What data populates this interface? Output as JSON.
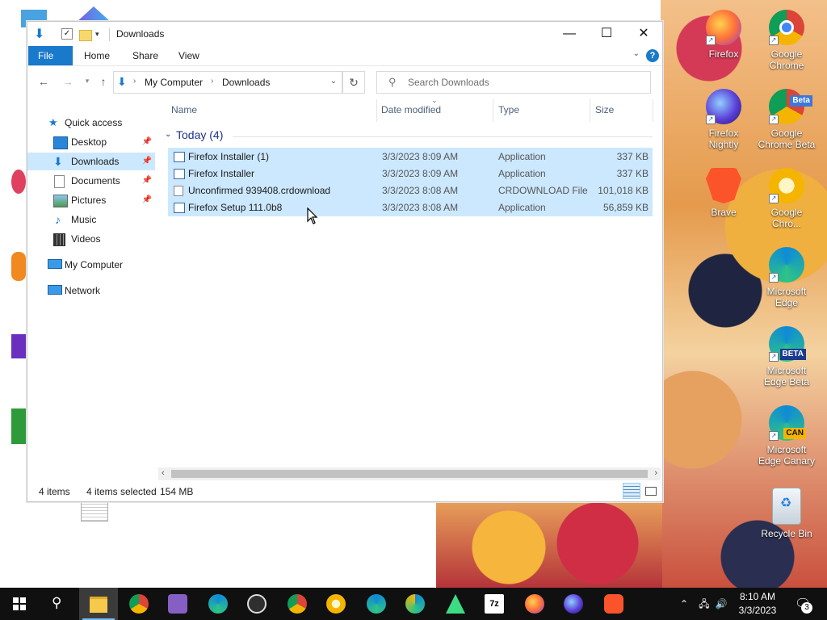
{
  "explorer": {
    "title": "Downloads",
    "window_buttons": {
      "minimize": "—",
      "maximize": "☐",
      "close": "✕"
    },
    "ribbon_tabs": [
      "File",
      "Home",
      "Share",
      "View"
    ],
    "help": "?",
    "address": {
      "crumbs": [
        "My Computer",
        "Downloads"
      ]
    },
    "search_placeholder": "Search Downloads",
    "nav": {
      "quick_access": "Quick access",
      "items": [
        "Desktop",
        "Downloads",
        "Documents",
        "Pictures",
        "Music",
        "Videos"
      ],
      "my_computer": "My Computer",
      "network": "Network"
    },
    "columns": [
      "Name",
      "Date modified",
      "Type",
      "Size"
    ],
    "group": "Today (4)",
    "files": [
      {
        "name": "Firefox Installer (1)",
        "date": "3/3/2023 8:09 AM",
        "type": "Application",
        "size": "337 KB"
      },
      {
        "name": "Firefox Installer",
        "date": "3/3/2023 8:09 AM",
        "type": "Application",
        "size": "337 KB"
      },
      {
        "name": "Unconfirmed 939408.crdownload",
        "date": "3/3/2023 8:08 AM",
        "type": "CRDOWNLOAD File",
        "size": "101,018 KB"
      },
      {
        "name": "Firefox Setup 111.0b8",
        "date": "3/3/2023 8:08 AM",
        "type": "Application",
        "size": "56,859 KB"
      }
    ],
    "status": {
      "count": "4 items",
      "selected": "4 items selected",
      "size": "154 MB"
    }
  },
  "desktop": {
    "icons": [
      {
        "label": "Firefox",
        "color": "#ff7139",
        "tag": ""
      },
      {
        "label": "Google Chrome",
        "color": "#4285f4",
        "tag": ""
      },
      {
        "label": "Firefox Nightly",
        "color": "#5b3fd8",
        "tag": ""
      },
      {
        "label": "Google Chrome Beta",
        "color": "#3c78d8",
        "tag": "Beta"
      },
      {
        "label": "Brave",
        "color": "#fb542b",
        "tag": ""
      },
      {
        "label": "Google Chro...",
        "color": "#f5b400",
        "tag": ""
      },
      {
        "label": "Microsoft Edge",
        "color": "#0f8bd6",
        "tag": ""
      },
      {
        "label": "Microsoft Edge Beta",
        "color": "#0f8bd6",
        "tag": "BETA"
      },
      {
        "label": "Microsoft Edge Canary",
        "color": "#0f8bd6",
        "tag": "CAN"
      },
      {
        "label": "Recycle Bin",
        "color": "#dfe6ee",
        "tag": ""
      }
    ]
  },
  "taskbar": {
    "apps": [
      "start",
      "search",
      "file-explorer",
      "chrome",
      "visual-studio",
      "edge",
      "obs",
      "chrome-beta",
      "chrome-canary",
      "edge-beta",
      "edge-canary",
      "android-studio",
      "7zip",
      "firefox",
      "firefox-nightly",
      "brave"
    ],
    "time": "8:10 AM",
    "date": "3/3/2023",
    "notifications": "3"
  }
}
